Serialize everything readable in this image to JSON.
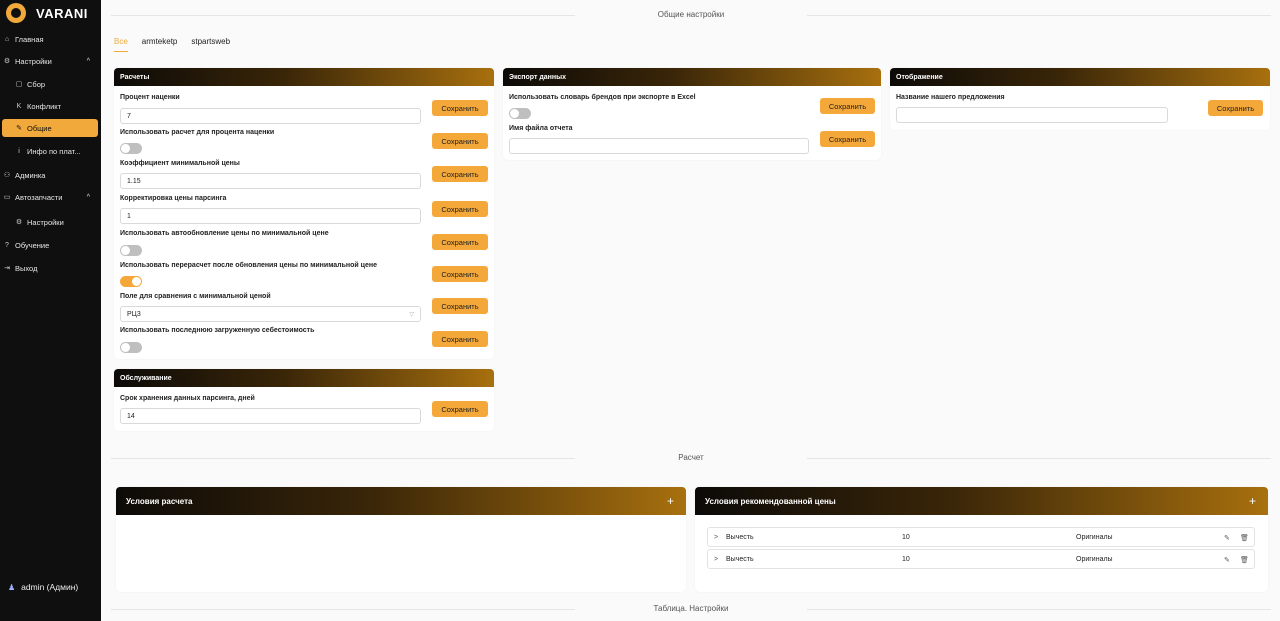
{
  "app": {
    "name": "VARANI"
  },
  "sidebar": {
    "items": [
      {
        "label": "Главная",
        "icon": "home-icon"
      },
      {
        "label": "Настройки",
        "icon": "gear-icon",
        "chevron": "^"
      },
      {
        "label": "Сбор",
        "icon": "box-icon"
      },
      {
        "label": "Конфликт",
        "icon": "k-icon"
      },
      {
        "label": "Общие",
        "icon": "pin-icon"
      },
      {
        "label": "Инфо по плат...",
        "icon": "info-icon"
      },
      {
        "label": "Админка",
        "icon": "users-icon"
      },
      {
        "label": "Автозапчасти",
        "icon": "car-icon",
        "chevron": "^"
      },
      {
        "label": "Настройки",
        "icon": "gear-icon"
      },
      {
        "label": "Обучение",
        "icon": "question-icon"
      },
      {
        "label": "Выход",
        "icon": "logout-icon"
      }
    ],
    "user": "admin (Админ)"
  },
  "sections": {
    "general": "Общие настройки",
    "calc": "Расчет",
    "table": "Таблица. Настройки"
  },
  "tabs": [
    "Все",
    "armteketp",
    "stpartsweb"
  ],
  "save_label": "Сохранить",
  "calc_card": {
    "title": "Расчеты",
    "markup_label": "Процент наценки",
    "markup_value": "7",
    "use_calc_label": "Использовать расчет для процента наценки",
    "use_calc_on": false,
    "min_price_label": "Коэффициент минимальной цены",
    "min_price_value": "1.15",
    "parse_adj_label": "Корректировка цены парсинга",
    "parse_adj_value": "1",
    "auto_update_label": "Использовать автообновление цены по минимальной цене",
    "auto_update_on": false,
    "recalc_label": "Использовать перерасчет после обновления цены по минимальной цене",
    "recalc_on": true,
    "compare_field_label": "Поле для сравнения с минимальной ценой",
    "compare_field_value": "РЦ3",
    "last_cost_label": "Использовать последнюю загруженную себестоимость",
    "last_cost_on": false
  },
  "service_card": {
    "title": "Обслуживание",
    "retention_label": "Срок хранения данных парсинга, дней",
    "retention_value": "14"
  },
  "export_card": {
    "title": "Экспорт данных",
    "brand_dict_label": "Использовать словарь брендов при экспорте в Excel",
    "brand_dict_on": false,
    "filename_label": "Имя файла отчета",
    "filename_value": ""
  },
  "display_card": {
    "title": "Отображение",
    "offer_name_label": "Название нашего предложения",
    "offer_name_value": ""
  },
  "conditions_card": {
    "title": "Условия расчета",
    "add": "+"
  },
  "recommended_card": {
    "title": "Условия рекомендованной цены",
    "add": "+",
    "rows": [
      {
        "action": "Вычесть",
        "value": "10",
        "type": "Оригиналы"
      },
      {
        "action": "Вычесть",
        "value": "10",
        "type": "Оригиналы"
      }
    ]
  },
  "colors": {
    "accent": "#f5a83a",
    "sidebar": "#0f0f0f"
  }
}
